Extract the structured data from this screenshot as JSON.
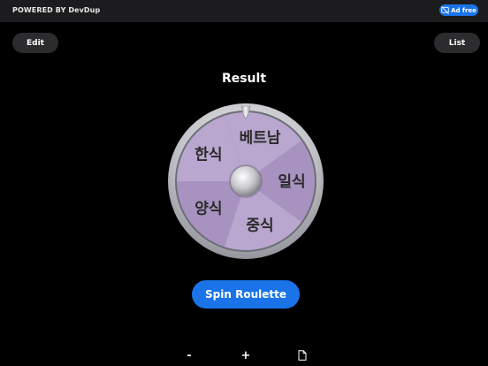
{
  "topbar": {
    "powered_by": "POWERED BY DevDup",
    "ad_free": "Ad free"
  },
  "header": {
    "edit_label": "Edit",
    "list_label": "List"
  },
  "result": {
    "title": "Result"
  },
  "wheel": {
    "segments": [
      {
        "label": "베트남"
      },
      {
        "label": "일식"
      },
      {
        "label": "중식"
      },
      {
        "label": "양식"
      },
      {
        "label": "한식"
      }
    ],
    "colors": {
      "light": "#b9a7cf",
      "dark": "#a892c0",
      "rim": "#c9c9cf"
    }
  },
  "actions": {
    "spin_label": "Spin Roulette"
  },
  "bottom": {
    "minus_label": "-",
    "plus_label": "+"
  }
}
